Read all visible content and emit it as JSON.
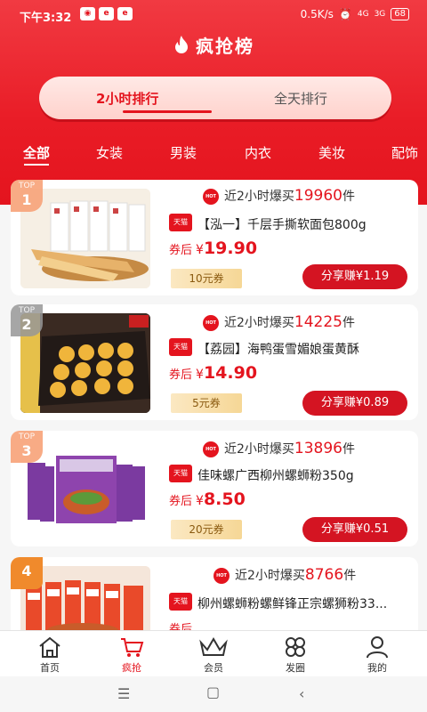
{
  "status_bar": {
    "time": "下午3:32",
    "net_speed": "0.5K/s",
    "battery": "68",
    "sig1": "4G",
    "sig2": "3G"
  },
  "header": {
    "title": "疯抢榜"
  },
  "time_tabs": [
    {
      "label": "2小时排行"
    },
    {
      "label": "全天排行"
    }
  ],
  "category_tabs": [
    {
      "label": "全部"
    },
    {
      "label": "女装"
    },
    {
      "label": "男装"
    },
    {
      "label": "内衣"
    },
    {
      "label": "美妆"
    },
    {
      "label": "配饰"
    }
  ],
  "products": [
    {
      "rank_top": "TOP",
      "rank": "1",
      "sold_prefix": "近2小时爆买",
      "sold_count": "19960",
      "sold_unit": "件",
      "store_badge": "天猫",
      "name": "【泓一】千层手撕软面包800g",
      "price_label": "券后",
      "currency": "¥",
      "price": "19.90",
      "coupon": "10元券",
      "share": "分享赚¥1.19"
    },
    {
      "rank_top": "TOP",
      "rank": "2",
      "sold_prefix": "近2小时爆买",
      "sold_count": "14225",
      "sold_unit": "件",
      "store_badge": "天猫",
      "name": "【荔园】海鸭蛋雪媚娘蛋黄酥",
      "price_label": "券后",
      "currency": "¥",
      "price": "14.90",
      "coupon": "5元券",
      "share": "分享赚¥0.89"
    },
    {
      "rank_top": "TOP",
      "rank": "3",
      "sold_prefix": "近2小时爆买",
      "sold_count": "13896",
      "sold_unit": "件",
      "store_badge": "天猫",
      "name": "佳味螺广西柳州螺蛳粉350g",
      "price_label": "券后",
      "currency": "¥",
      "price": "8.50",
      "coupon": "20元券",
      "share": "分享赚¥0.51"
    },
    {
      "rank_top": "",
      "rank": "4",
      "sold_prefix": "近2小时爆买",
      "sold_count": "8766",
      "sold_unit": "件",
      "store_badge": "天猫",
      "name": "柳州螺蛳粉螺鲜锋正宗螺狮粉33...",
      "price_label": "券后",
      "currency": "¥",
      "price": "",
      "coupon": "",
      "share": ""
    }
  ],
  "bottom_nav": [
    {
      "label": "首页",
      "icon": "home-icon"
    },
    {
      "label": "疯抢",
      "icon": "cart-icon"
    },
    {
      "label": "会员",
      "icon": "crown-icon"
    },
    {
      "label": "发圈",
      "icon": "clover-icon"
    },
    {
      "label": "我的",
      "icon": "user-icon"
    }
  ],
  "colors": {
    "brand_red": "#e4141e",
    "coupon_gold": "#f6d796",
    "rank1": "#f7a278",
    "rank2": "#b3b3b3",
    "rank4": "#f08a2c"
  }
}
